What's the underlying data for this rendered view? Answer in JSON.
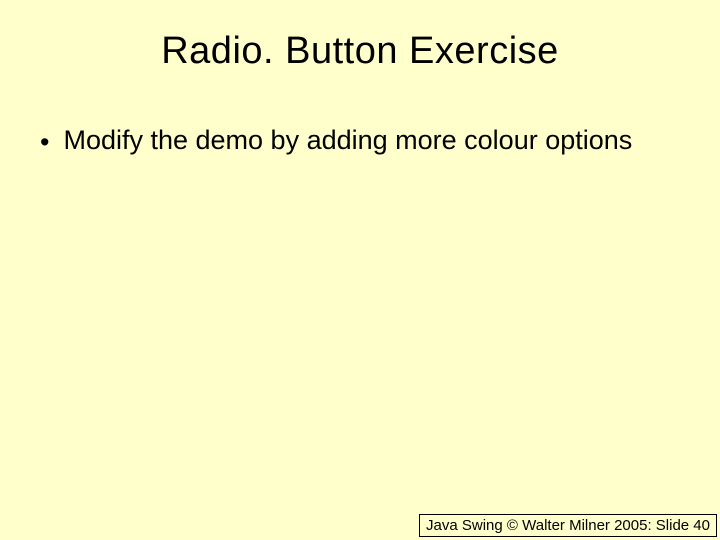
{
  "title": "Radio. Button Exercise",
  "bullets": [
    {
      "text": "Modify the demo by adding more colour options"
    }
  ],
  "footer": "Java Swing © Walter Milner 2005: Slide 40"
}
